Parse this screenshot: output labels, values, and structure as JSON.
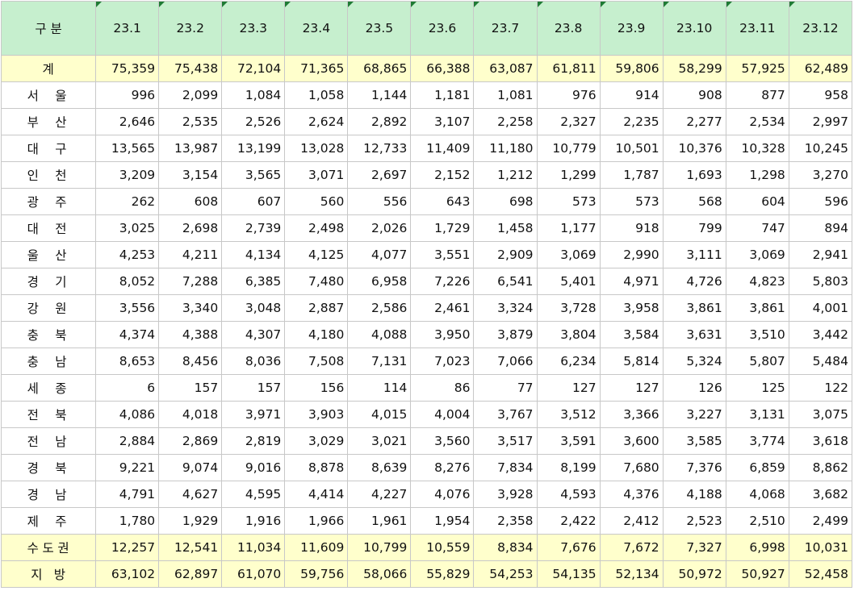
{
  "header": {
    "corner": "구 분",
    "months": [
      "23.1",
      "23.2",
      "23.3",
      "23.4",
      "23.5",
      "23.6",
      "23.7",
      "23.8",
      "23.9",
      "23.10",
      "23.11",
      "23.12"
    ]
  },
  "rows": [
    {
      "label": "계",
      "kind": "total",
      "values": [
        "75,359",
        "75,438",
        "72,104",
        "71,365",
        "68,865",
        "66,388",
        "63,087",
        "61,811",
        "59,806",
        "58,299",
        "57,925",
        "62,489"
      ]
    },
    {
      "label": "서 울",
      "kind": "region",
      "values": [
        "996",
        "2,099",
        "1,084",
        "1,058",
        "1,144",
        "1,181",
        "1,081",
        "976",
        "914",
        "908",
        "877",
        "958"
      ]
    },
    {
      "label": "부 산",
      "kind": "region",
      "values": [
        "2,646",
        "2,535",
        "2,526",
        "2,624",
        "2,892",
        "3,107",
        "2,258",
        "2,327",
        "2,235",
        "2,277",
        "2,534",
        "2,997"
      ]
    },
    {
      "label": "대 구",
      "kind": "region",
      "values": [
        "13,565",
        "13,987",
        "13,199",
        "13,028",
        "12,733",
        "11,409",
        "11,180",
        "10,779",
        "10,501",
        "10,376",
        "10,328",
        "10,245"
      ]
    },
    {
      "label": "인 천",
      "kind": "region",
      "values": [
        "3,209",
        "3,154",
        "3,565",
        "3,071",
        "2,697",
        "2,152",
        "1,212",
        "1,299",
        "1,787",
        "1,693",
        "1,298",
        "3,270"
      ]
    },
    {
      "label": "광 주",
      "kind": "region",
      "values": [
        "262",
        "608",
        "607",
        "560",
        "556",
        "643",
        "698",
        "573",
        "573",
        "568",
        "604",
        "596"
      ]
    },
    {
      "label": "대 전",
      "kind": "region",
      "values": [
        "3,025",
        "2,698",
        "2,739",
        "2,498",
        "2,026",
        "1,729",
        "1,458",
        "1,177",
        "918",
        "799",
        "747",
        "894"
      ]
    },
    {
      "label": "울 산",
      "kind": "region",
      "values": [
        "4,253",
        "4,211",
        "4,134",
        "4,125",
        "4,077",
        "3,551",
        "2,909",
        "3,069",
        "2,990",
        "3,111",
        "3,069",
        "2,941"
      ]
    },
    {
      "label": "경 기",
      "kind": "region",
      "values": [
        "8,052",
        "7,288",
        "6,385",
        "7,480",
        "6,958",
        "7,226",
        "6,541",
        "5,401",
        "4,971",
        "4,726",
        "4,823",
        "5,803"
      ]
    },
    {
      "label": "강 원",
      "kind": "region",
      "values": [
        "3,556",
        "3,340",
        "3,048",
        "2,887",
        "2,586",
        "2,461",
        "3,324",
        "3,728",
        "3,958",
        "3,861",
        "3,861",
        "4,001"
      ]
    },
    {
      "label": "충 북",
      "kind": "region",
      "values": [
        "4,374",
        "4,388",
        "4,307",
        "4,180",
        "4,088",
        "3,950",
        "3,879",
        "3,804",
        "3,584",
        "3,631",
        "3,510",
        "3,442"
      ]
    },
    {
      "label": "충 남",
      "kind": "region",
      "values": [
        "8,653",
        "8,456",
        "8,036",
        "7,508",
        "7,131",
        "7,023",
        "7,066",
        "6,234",
        "5,814",
        "5,324",
        "5,807",
        "5,484"
      ]
    },
    {
      "label": "세 종",
      "kind": "region",
      "values": [
        "6",
        "157",
        "157",
        "156",
        "114",
        "86",
        "77",
        "127",
        "127",
        "126",
        "125",
        "122"
      ]
    },
    {
      "label": "전 북",
      "kind": "region",
      "values": [
        "4,086",
        "4,018",
        "3,971",
        "3,903",
        "4,015",
        "4,004",
        "3,767",
        "3,512",
        "3,366",
        "3,227",
        "3,131",
        "3,075"
      ]
    },
    {
      "label": "전 남",
      "kind": "region",
      "values": [
        "2,884",
        "2,869",
        "2,819",
        "3,029",
        "3,021",
        "3,560",
        "3,517",
        "3,591",
        "3,600",
        "3,585",
        "3,774",
        "3,618"
      ]
    },
    {
      "label": "경 북",
      "kind": "region",
      "values": [
        "9,221",
        "9,074",
        "9,016",
        "8,878",
        "8,639",
        "8,276",
        "7,834",
        "8,199",
        "7,680",
        "7,376",
        "6,859",
        "8,862"
      ]
    },
    {
      "label": "경 남",
      "kind": "region",
      "values": [
        "4,791",
        "4,627",
        "4,595",
        "4,414",
        "4,227",
        "4,076",
        "3,928",
        "4,593",
        "4,376",
        "4,188",
        "4,068",
        "3,682"
      ]
    },
    {
      "label": "제 주",
      "kind": "region",
      "values": [
        "1,780",
        "1,929",
        "1,916",
        "1,966",
        "1,961",
        "1,954",
        "2,358",
        "2,422",
        "2,412",
        "2,523",
        "2,510",
        "2,499"
      ]
    },
    {
      "label": "수도권",
      "kind": "summary",
      "values": [
        "12,257",
        "12,541",
        "11,034",
        "11,609",
        "10,799",
        "10,559",
        "8,834",
        "7,676",
        "7,672",
        "7,327",
        "6,998",
        "10,031"
      ]
    },
    {
      "label": "지 방",
      "kind": "summary",
      "values": [
        "63,102",
        "62,897",
        "61,070",
        "59,756",
        "58,066",
        "55,829",
        "54,253",
        "54,135",
        "52,134",
        "50,972",
        "50,927",
        "52,458"
      ]
    }
  ],
  "colors": {
    "header_bg": "#c6efce",
    "highlight_bg": "#ffffcc",
    "corner_marker": "#1e7b34",
    "grid_line": "#c8c8c8"
  }
}
